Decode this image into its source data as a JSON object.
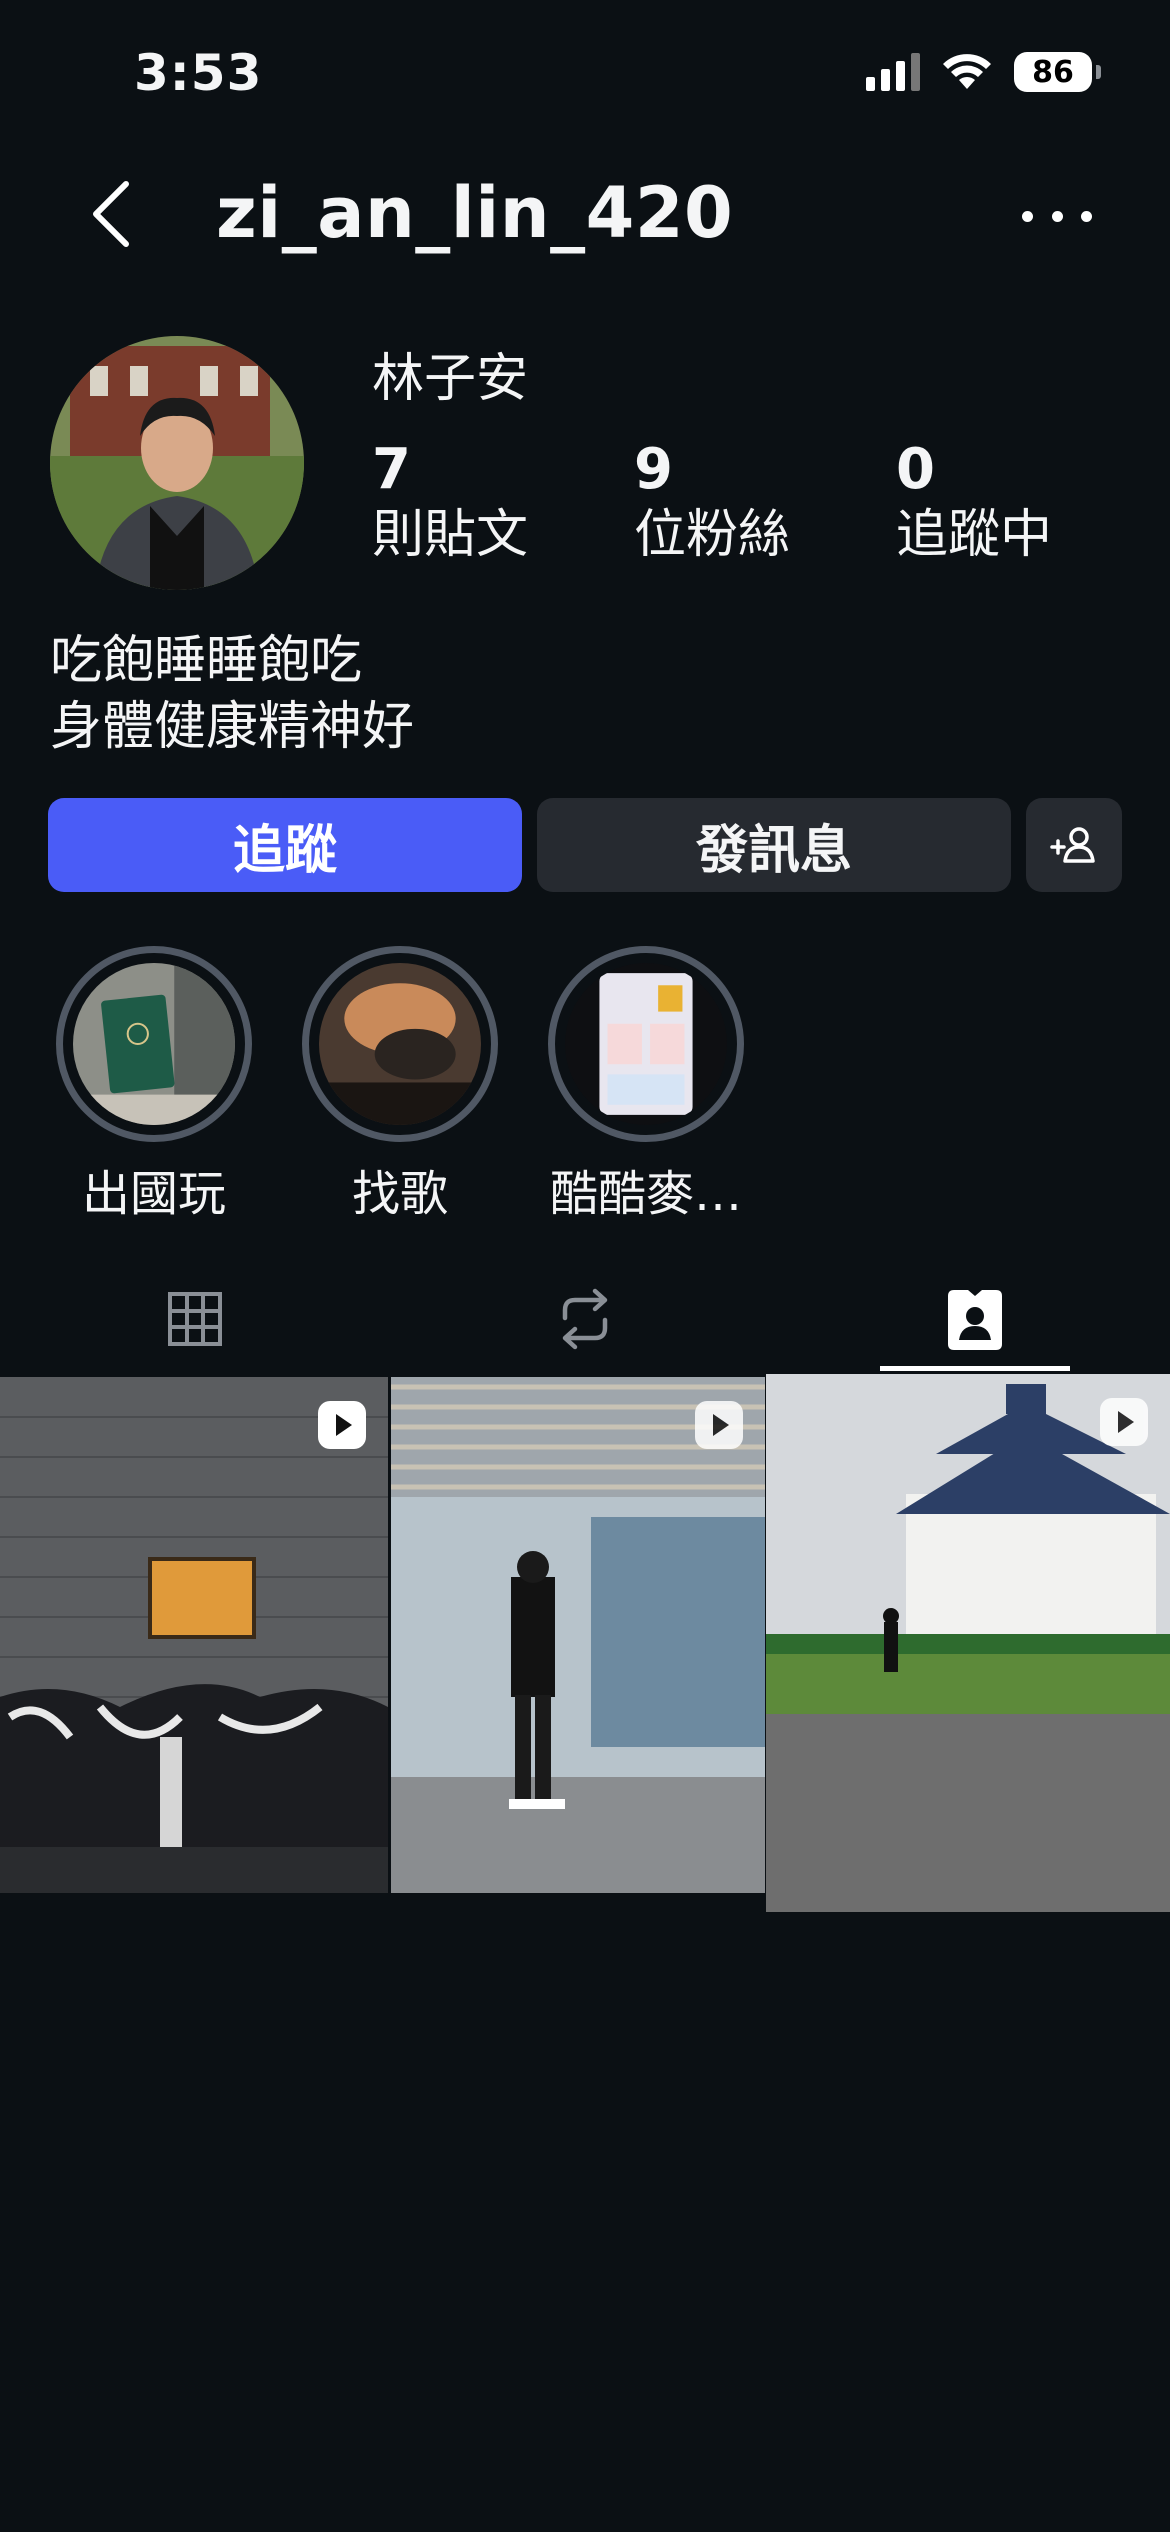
{
  "status_bar": {
    "time": "3:53",
    "battery": "86"
  },
  "header": {
    "username": "zi_an_lin_420"
  },
  "profile": {
    "display_name": "林子安",
    "stats": [
      {
        "count": "7",
        "label": "則貼文"
      },
      {
        "count": "9",
        "label": "位粉絲"
      },
      {
        "count": "0",
        "label": "追蹤中"
      }
    ],
    "bio": [
      "吃飽睡睡飽吃",
      "身體健康精神好"
    ]
  },
  "actions": {
    "follow": "追蹤",
    "message": "發訊息"
  },
  "highlights": [
    {
      "label": "出國玩"
    },
    {
      "label": "找歌"
    },
    {
      "label": "酷酷麥…"
    }
  ],
  "tabs": {
    "active": "tagged"
  },
  "colors": {
    "background": "#0b1014",
    "accent": "#4a5cf7",
    "button": "#262a30"
  },
  "icons": [
    "back-icon",
    "more-icon",
    "add-person-icon",
    "grid-icon",
    "reposts-icon",
    "tagged-icon",
    "reel-icon"
  ]
}
